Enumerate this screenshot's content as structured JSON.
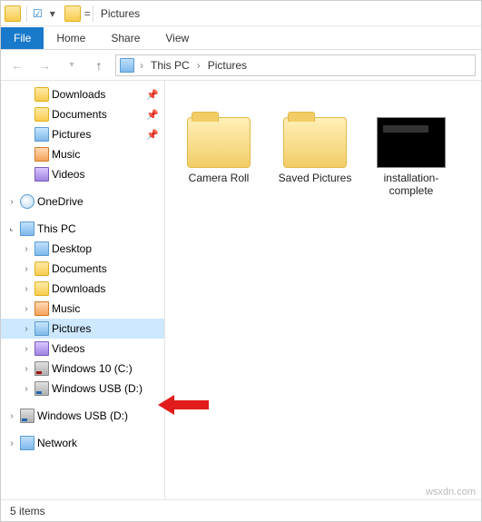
{
  "window": {
    "title": "Pictures",
    "equals": "="
  },
  "ribbon": {
    "file": "File",
    "tabs": [
      "Home",
      "Share",
      "View"
    ]
  },
  "breadcrumb": {
    "root": "This PC",
    "current": "Pictures"
  },
  "quick_access_extra": [
    {
      "label": "Downloads",
      "icon": "folder",
      "pinned": true
    },
    {
      "label": "Documents",
      "icon": "folder",
      "pinned": true
    },
    {
      "label": "Pictures",
      "icon": "pictures",
      "pinned": true
    },
    {
      "label": "Music",
      "icon": "music",
      "pinned": false
    },
    {
      "label": "Videos",
      "icon": "videos",
      "pinned": false
    }
  ],
  "onedrive": {
    "label": "OneDrive",
    "icon": "cloud"
  },
  "this_pc": {
    "label": "This PC",
    "icon": "pc",
    "children": [
      {
        "label": "Desktop",
        "icon": "pc",
        "arrow": ">"
      },
      {
        "label": "Documents",
        "icon": "folder",
        "arrow": ">"
      },
      {
        "label": "Downloads",
        "icon": "folder",
        "arrow": ">"
      },
      {
        "label": "Music",
        "icon": "music",
        "arrow": ">"
      },
      {
        "label": "Pictures",
        "icon": "pictures",
        "arrow": ">",
        "selected": true
      },
      {
        "label": "Videos",
        "icon": "videos",
        "arrow": ">"
      },
      {
        "label": "Windows 10 (C:)",
        "icon": "drive",
        "arrow": ">"
      },
      {
        "label": "Windows USB (D:)",
        "icon": "usb",
        "arrow": ">"
      }
    ]
  },
  "root_extras": [
    {
      "label": "Windows USB (D:)",
      "icon": "usb",
      "arrow": ">"
    },
    {
      "label": "Network",
      "icon": "net",
      "arrow": ">"
    }
  ],
  "content": [
    {
      "type": "folder",
      "label": "Camera Roll"
    },
    {
      "type": "folder",
      "label": "Saved Pictures"
    },
    {
      "type": "image",
      "label": "installation-complete"
    }
  ],
  "status": {
    "text": "5 items"
  },
  "watermark": "wsxdn.com"
}
